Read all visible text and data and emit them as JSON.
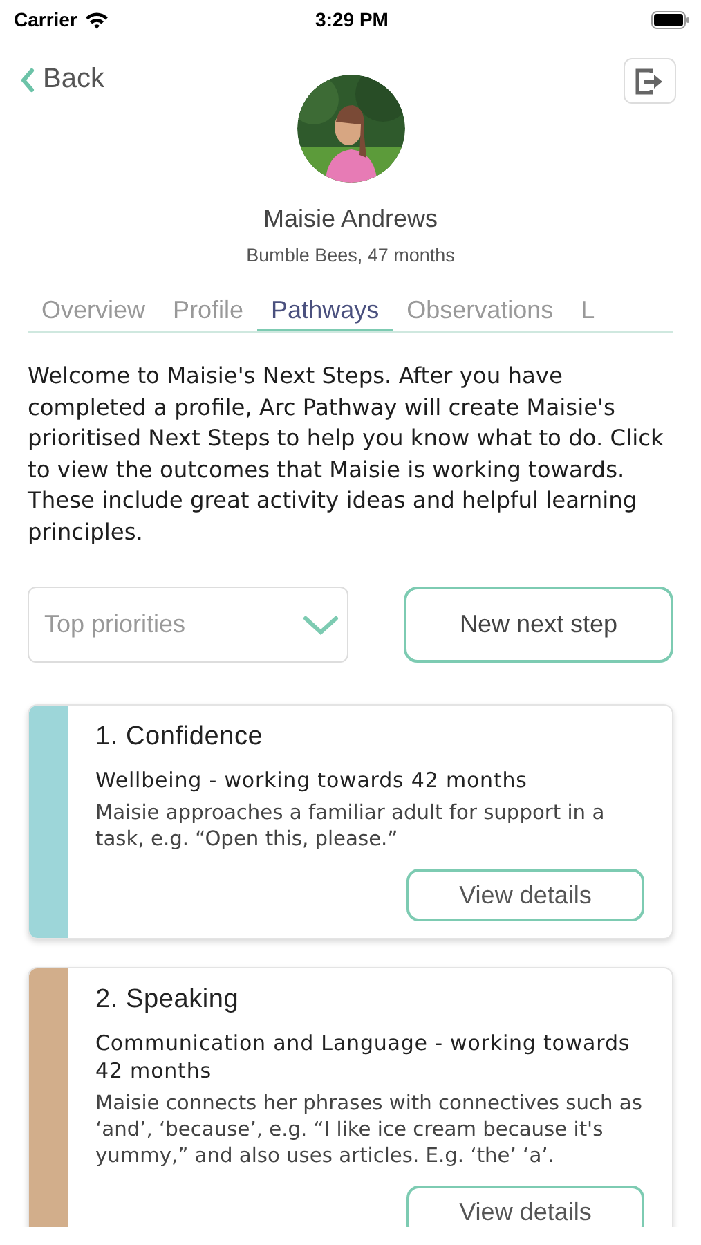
{
  "status_bar": {
    "carrier": "Carrier",
    "time": "3:29 PM"
  },
  "nav": {
    "back": "Back"
  },
  "profile": {
    "name": "Maisie Andrews",
    "details": "Bumble Bees, 47 months"
  },
  "tabs": [
    {
      "label": "Overview",
      "selected": false
    },
    {
      "label": "Profile",
      "selected": false
    },
    {
      "label": "Pathways",
      "selected": true
    },
    {
      "label": "Observations",
      "selected": false
    },
    {
      "label": "L",
      "selected": false
    }
  ],
  "intro": "Welcome to Maisie's Next Steps. After you have completed a profile, Arc Pathway will create Maisie's prioritised Next Steps to help you know what to do. Click to view the outcomes that Maisie is working towards. These include great activity ideas and helpful learning principles.",
  "filter": {
    "value": "Top priorities"
  },
  "new_button": "New next step",
  "cards": [
    {
      "title": "1. Confidence",
      "area": "Wellbeing - working towards 42 months",
      "description": "Maisie approaches a familiar adult for support in a task, e.g. “Open this, please.”",
      "button": "View details",
      "color": "#9dd6d9"
    },
    {
      "title": "2. Speaking",
      "area": "Communication and Language - working towards 42 months",
      "description": "Maisie connects her phrases with connectives such as ‘and’, ‘because’, e.g. “I like ice cream because it's yummy,” and also uses articles. E.g. ‘the’ ‘a’.",
      "button": "View details",
      "color": "#d2ae8b"
    }
  ]
}
